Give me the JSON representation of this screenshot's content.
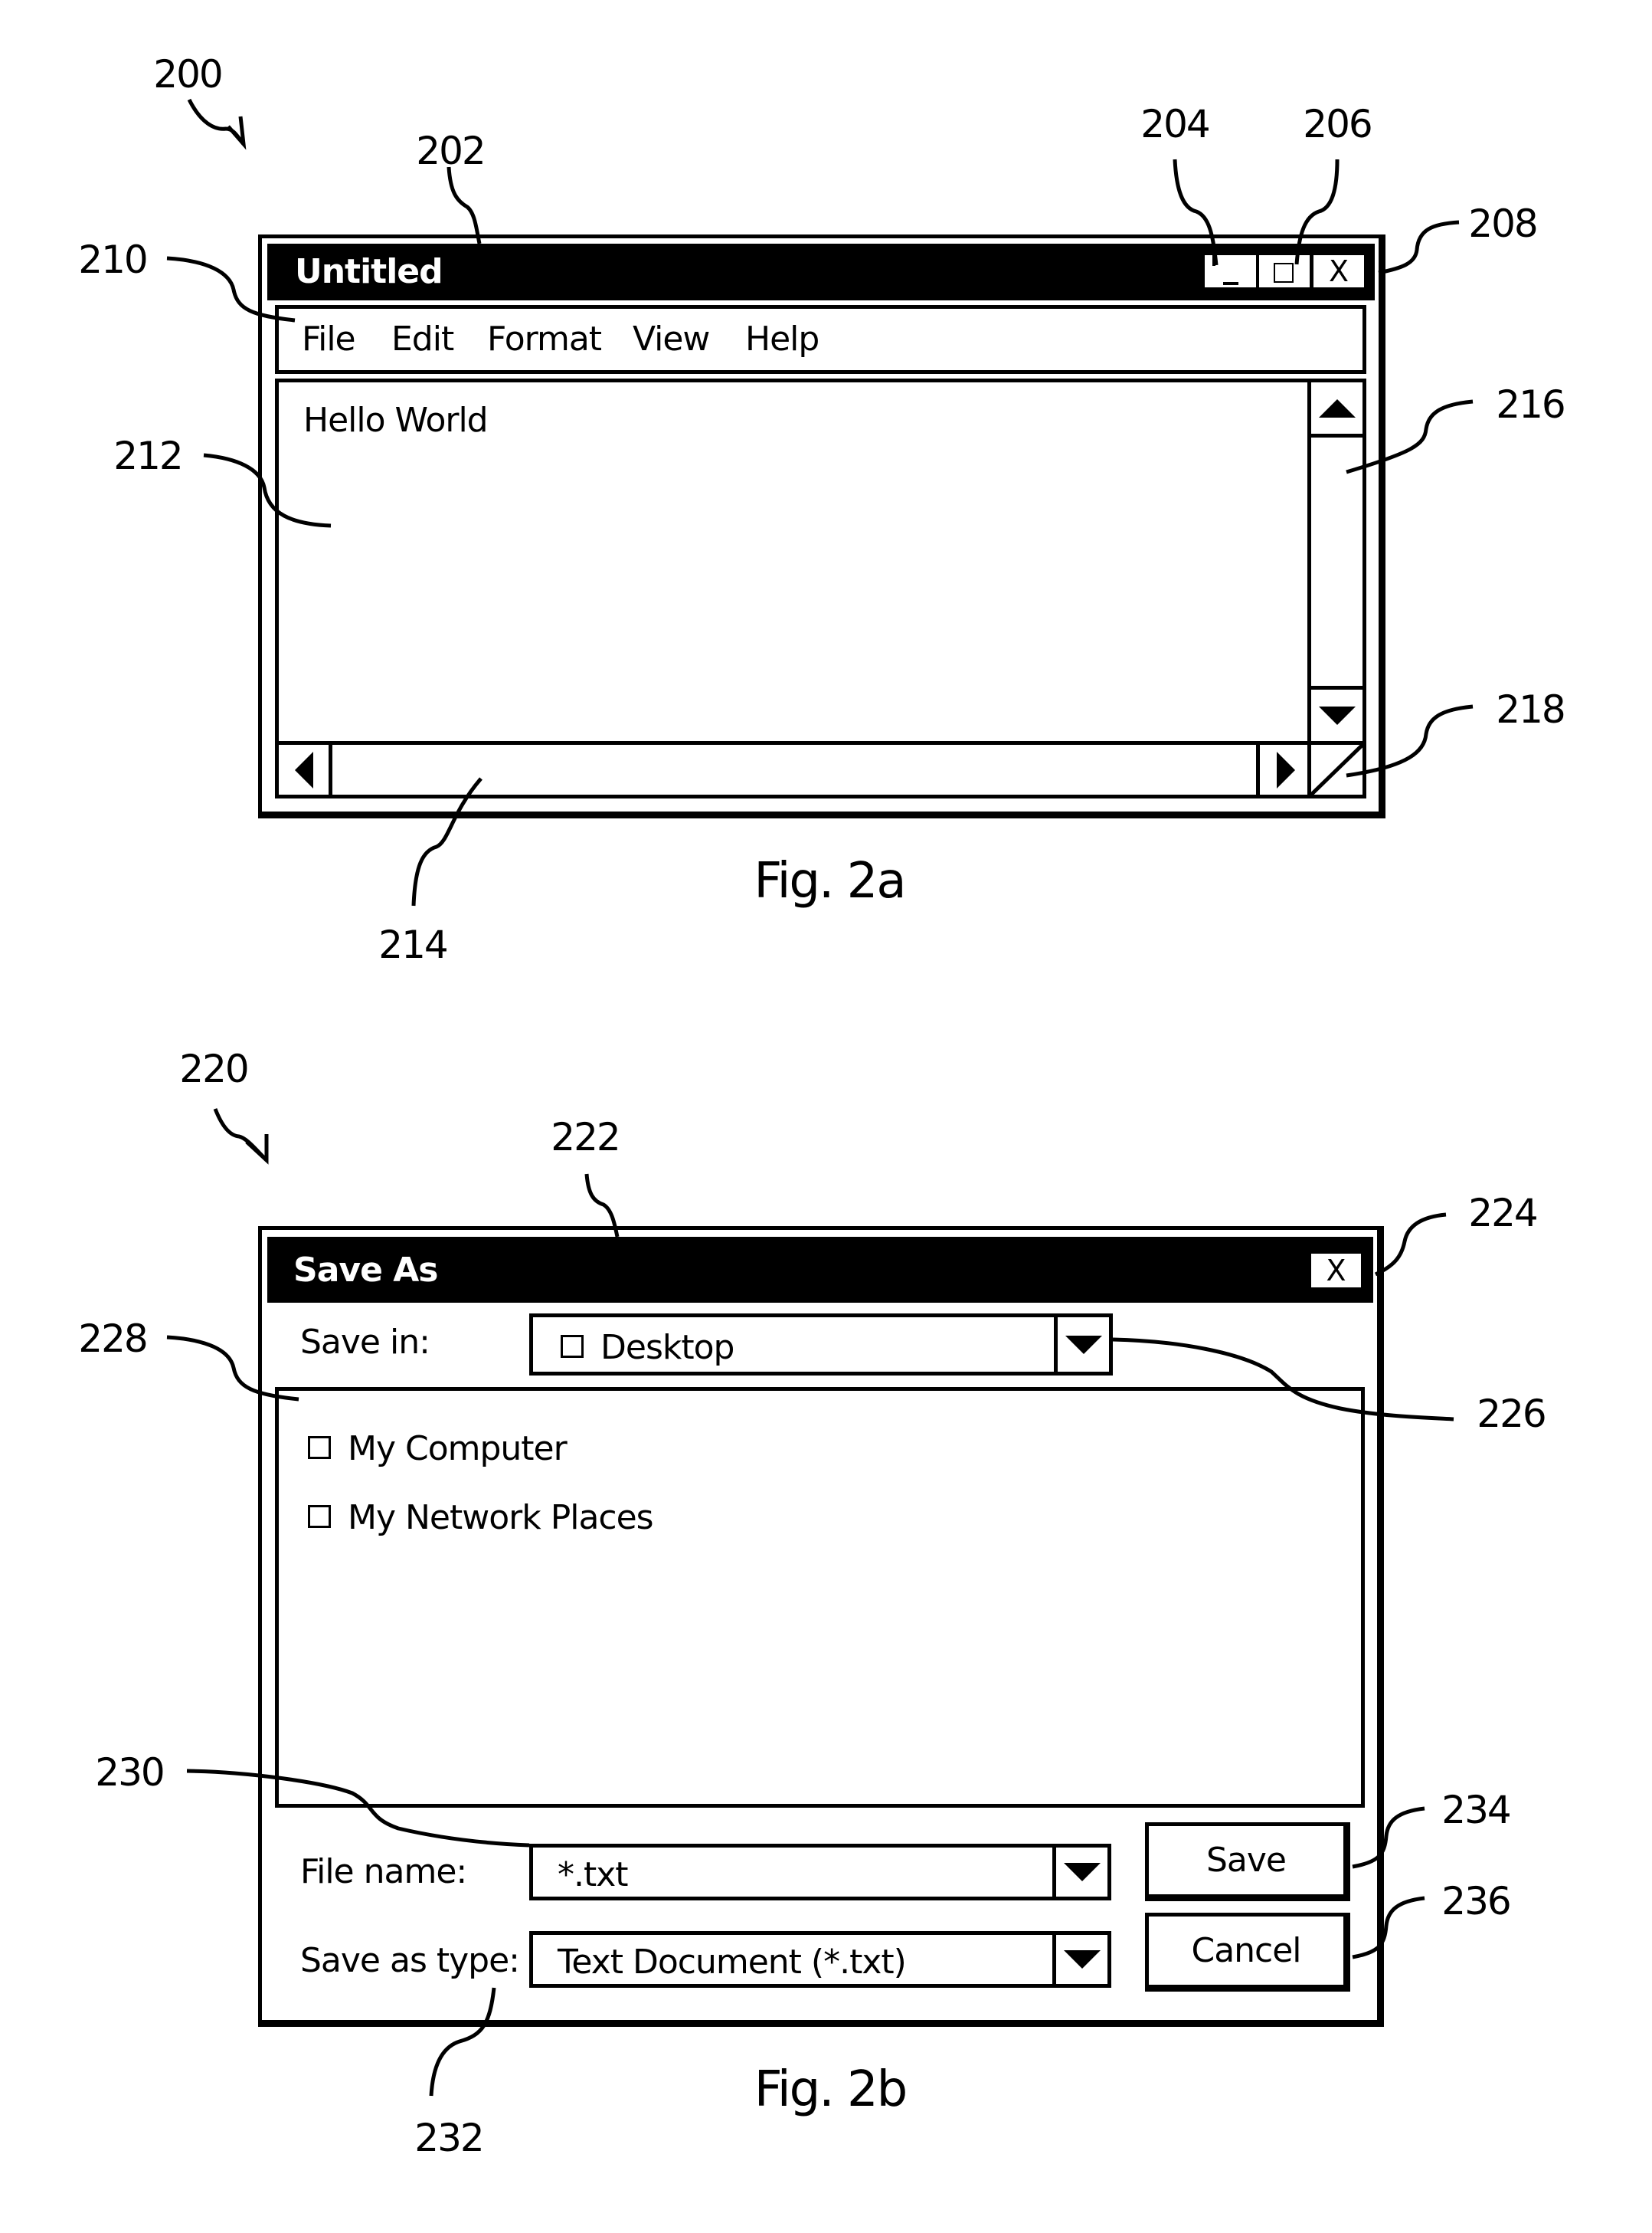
{
  "fig_2a": {
    "caption": "Fig. 2a",
    "refs": {
      "window": "200",
      "title_bar": "202",
      "minimize": "204",
      "maximize": "206",
      "close": "208",
      "menu_bar": "210",
      "text_area": "212",
      "horizontal_scrollbar": "214",
      "vertical_scrollbar": "216",
      "resize_grip": "218"
    },
    "window": {
      "title": "Untitled",
      "title_buttons": {
        "minimize_icon": "minimize-icon",
        "maximize_icon": "maximize-icon",
        "close_label": "X"
      },
      "menu": [
        "File",
        "Edit",
        "Format",
        "View",
        "Help"
      ],
      "document_text": "Hello World"
    }
  },
  "fig_2b": {
    "caption": "Fig. 2b",
    "refs": {
      "dialog": "220",
      "title_bar": "222",
      "close": "224",
      "save_in_dropdown": "226",
      "file_list": "228",
      "file_name_field": "230",
      "save_as_type_dropdown": "232",
      "save_button": "234",
      "cancel_button": "236"
    },
    "dialog": {
      "title": "Save As",
      "close_label": "X",
      "save_in_label": "Save in:",
      "save_in_value": "Desktop",
      "file_list": [
        {
          "label": "My Computer",
          "icon": "folder-icon"
        },
        {
          "label": "My Network Places",
          "icon": "folder-icon"
        }
      ],
      "file_name_label": "File name:",
      "file_name_value": "*.txt",
      "save_as_type_label": "Save as type:",
      "save_as_type_value": "Text Document (*.txt)",
      "save_label": "Save",
      "cancel_label": "Cancel"
    }
  }
}
